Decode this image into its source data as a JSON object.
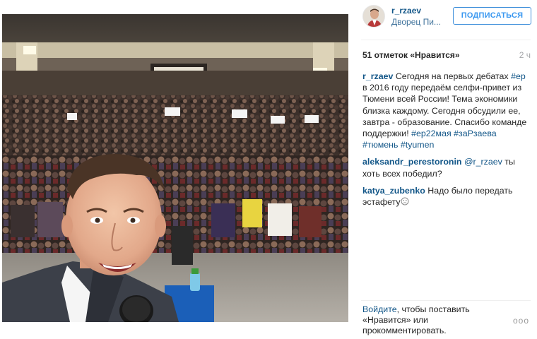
{
  "post": {
    "username": "r_rzaev",
    "location": "Дворец Пи...",
    "follow_label": "ПОДПИСАТЬСЯ",
    "likes": "51 отметок «Нравится»",
    "time": "2 ч"
  },
  "caption": {
    "user": "r_rzaev",
    "t1": " Сегодня на первых дебатах ",
    "tag1": "#ер",
    "t2": " в 2016 году передаём селфи-привет из Тюмени всей России! Тема экономики близка каждому. Сегодня обсудили ее, завтра - образование. Спасибо команде поддержки! ",
    "tag2": "#ер22мая",
    "tag3": "#заРзаева",
    "tag4": "#тюмень",
    "tag5": "#tyumen"
  },
  "comments": [
    {
      "user": "aleksandr_perestoronin",
      "mention": "@r_rzaev",
      "text": " ты хоть всех победил?"
    },
    {
      "user": "katya_zubenko",
      "text": " Надо было передать эстафету"
    }
  ],
  "footer": {
    "login": "Войдите",
    "rest": ", чтобы поставить «Нравится» или прокомментировать.",
    "more": "ooo"
  },
  "colors": {
    "link": "#125688",
    "follow": "#3897f0",
    "muted": "#a5a7aa"
  },
  "icons": {
    "smile": "slightly-frowning-face-icon",
    "more": "more-options-icon"
  }
}
